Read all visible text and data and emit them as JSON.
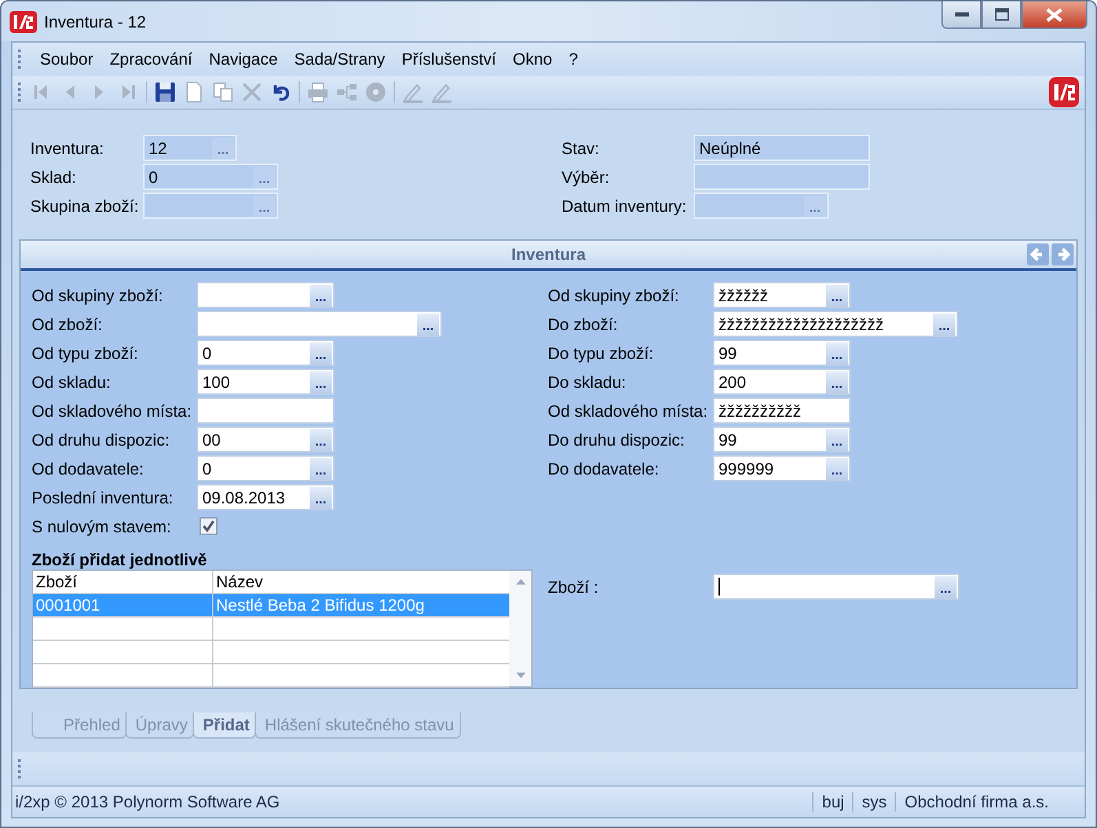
{
  "window": {
    "title": "Inventura - 12"
  },
  "menu": [
    "Soubor",
    "Zpracování",
    "Navigace",
    "Sada/Strany",
    "Příslušenství",
    "Okno",
    "?"
  ],
  "toolbar": [
    {
      "kind": "first",
      "disabled": true
    },
    {
      "kind": "prev",
      "disabled": true
    },
    {
      "kind": "next",
      "disabled": true
    },
    {
      "kind": "last",
      "disabled": true
    },
    {
      "kind": "save",
      "disabled": false
    },
    {
      "kind": "new",
      "disabled": true
    },
    {
      "kind": "copy",
      "disabled": true
    },
    {
      "kind": "delete",
      "disabled": true
    },
    {
      "kind": "undo",
      "disabled": false
    },
    {
      "kind": "print",
      "disabled": true
    },
    {
      "kind": "tree",
      "disabled": true
    },
    {
      "kind": "disc",
      "disabled": true
    },
    {
      "kind": "pen",
      "disabled": true
    },
    {
      "kind": "pen",
      "disabled": true
    }
  ],
  "header": {
    "left": [
      {
        "label": "Inventura:",
        "value": "12",
        "browse": "...",
        "kind": "tiny"
      },
      {
        "label": "Sklad:",
        "value": "0",
        "browse": "...",
        "kind": "short"
      },
      {
        "label": "Skupina zboží:",
        "browse": "...",
        "kind": "short"
      }
    ],
    "right": [
      {
        "label": "Stav:",
        "value": "Neúplné",
        "kind": "plain"
      },
      {
        "label": "Výběr:",
        "kind": "plain"
      },
      {
        "label": "Datum inventury:",
        "browse": "...",
        "kind": "short"
      }
    ]
  },
  "panel": {
    "title": "Inventura",
    "left": [
      {
        "label": "Od skupiny zboží:",
        "browse": "...",
        "kind": "short"
      },
      {
        "label": "Od zboží:",
        "browse": "...",
        "kind": "wide"
      },
      {
        "label": "Od typu zboží:",
        "value": "0",
        "browse": "...",
        "kind": "short"
      },
      {
        "label": "Od skladu:",
        "value": "100",
        "browse": "...",
        "kind": "short"
      },
      {
        "label": "Od skladového místa:",
        "kind": "plain"
      },
      {
        "label": "Od druhu dispozic:",
        "value": "00",
        "browse": "...",
        "kind": "short"
      },
      {
        "label": "Od dodavatele:",
        "value": "0",
        "browse": "...",
        "kind": "short"
      },
      {
        "label": "Poslední inventura:",
        "value": "09.08.2013",
        "browse": "...",
        "kind": "short"
      },
      {
        "label": "S nulovým stavem:",
        "kind": "check",
        "checked": true
      }
    ],
    "right": [
      {
        "label": "Od skupiny zboží:",
        "value": "žžžžžž",
        "browse": "...",
        "kind": "short"
      },
      {
        "label": "Do zboží:",
        "value": "žžžžžžžžžžžžžžžžžžžž",
        "browse": "...",
        "kind": "wide"
      },
      {
        "label": "Do typu zboží:",
        "value": "99",
        "browse": "...",
        "kind": "short"
      },
      {
        "label": "Do skladu:",
        "value": "200",
        "browse": "...",
        "kind": "short"
      },
      {
        "label": "Od skladového místa:",
        "value": "žžžžžžžžžž",
        "kind": "plain"
      },
      {
        "label": "Do druhu dispozic:",
        "value": "99",
        "browse": "...",
        "kind": "short"
      },
      {
        "label": "Do dodavatele:",
        "value": "999999",
        "browse": "...",
        "kind": "short"
      }
    ],
    "section_title": "Zboží přidat jednotlivě",
    "table": {
      "columns": [
        "Zboží",
        "Název"
      ],
      "rows": [
        {
          "cells": [
            "0001001",
            "Nestlé Beba 2 Bifidus 1200g"
          ],
          "selected": true
        }
      ]
    },
    "item_field": {
      "label": "Zboží :",
      "browse": "...",
      "focused": true
    }
  },
  "tabs": [
    {
      "label": "Přehled",
      "selected": false
    },
    {
      "label": "Úpravy",
      "selected": false
    },
    {
      "label": "Přidat",
      "selected": true
    },
    {
      "label": "Hlášení skutečného stavu",
      "selected": false
    }
  ],
  "status_bar": {
    "copyright": "i/2xp © 2013 Polynorm Software AG",
    "user": "buj",
    "database": "sys",
    "company": "Obchodní firma a.s."
  }
}
